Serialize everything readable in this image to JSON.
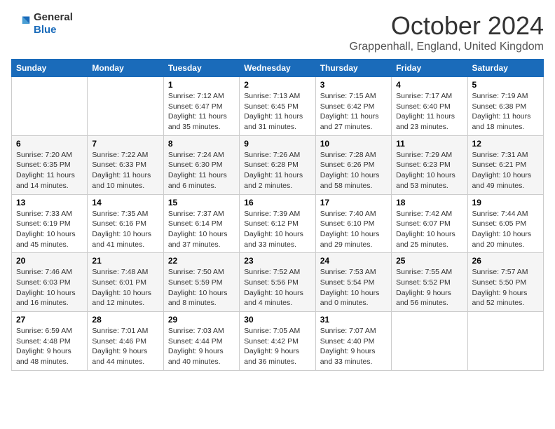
{
  "logo": {
    "general": "General",
    "blue": "Blue"
  },
  "header": {
    "month": "October 2024",
    "location": "Grappenhall, England, United Kingdom"
  },
  "weekdays": [
    "Sunday",
    "Monday",
    "Tuesday",
    "Wednesday",
    "Thursday",
    "Friday",
    "Saturday"
  ],
  "weeks": [
    [
      {
        "day": "",
        "info": ""
      },
      {
        "day": "",
        "info": ""
      },
      {
        "day": "1",
        "info": "Sunrise: 7:12 AM\nSunset: 6:47 PM\nDaylight: 11 hours and 35 minutes."
      },
      {
        "day": "2",
        "info": "Sunrise: 7:13 AM\nSunset: 6:45 PM\nDaylight: 11 hours and 31 minutes."
      },
      {
        "day": "3",
        "info": "Sunrise: 7:15 AM\nSunset: 6:42 PM\nDaylight: 11 hours and 27 minutes."
      },
      {
        "day": "4",
        "info": "Sunrise: 7:17 AM\nSunset: 6:40 PM\nDaylight: 11 hours and 23 minutes."
      },
      {
        "day": "5",
        "info": "Sunrise: 7:19 AM\nSunset: 6:38 PM\nDaylight: 11 hours and 18 minutes."
      }
    ],
    [
      {
        "day": "6",
        "info": "Sunrise: 7:20 AM\nSunset: 6:35 PM\nDaylight: 11 hours and 14 minutes."
      },
      {
        "day": "7",
        "info": "Sunrise: 7:22 AM\nSunset: 6:33 PM\nDaylight: 11 hours and 10 minutes."
      },
      {
        "day": "8",
        "info": "Sunrise: 7:24 AM\nSunset: 6:30 PM\nDaylight: 11 hours and 6 minutes."
      },
      {
        "day": "9",
        "info": "Sunrise: 7:26 AM\nSunset: 6:28 PM\nDaylight: 11 hours and 2 minutes."
      },
      {
        "day": "10",
        "info": "Sunrise: 7:28 AM\nSunset: 6:26 PM\nDaylight: 10 hours and 58 minutes."
      },
      {
        "day": "11",
        "info": "Sunrise: 7:29 AM\nSunset: 6:23 PM\nDaylight: 10 hours and 53 minutes."
      },
      {
        "day": "12",
        "info": "Sunrise: 7:31 AM\nSunset: 6:21 PM\nDaylight: 10 hours and 49 minutes."
      }
    ],
    [
      {
        "day": "13",
        "info": "Sunrise: 7:33 AM\nSunset: 6:19 PM\nDaylight: 10 hours and 45 minutes."
      },
      {
        "day": "14",
        "info": "Sunrise: 7:35 AM\nSunset: 6:16 PM\nDaylight: 10 hours and 41 minutes."
      },
      {
        "day": "15",
        "info": "Sunrise: 7:37 AM\nSunset: 6:14 PM\nDaylight: 10 hours and 37 minutes."
      },
      {
        "day": "16",
        "info": "Sunrise: 7:39 AM\nSunset: 6:12 PM\nDaylight: 10 hours and 33 minutes."
      },
      {
        "day": "17",
        "info": "Sunrise: 7:40 AM\nSunset: 6:10 PM\nDaylight: 10 hours and 29 minutes."
      },
      {
        "day": "18",
        "info": "Sunrise: 7:42 AM\nSunset: 6:07 PM\nDaylight: 10 hours and 25 minutes."
      },
      {
        "day": "19",
        "info": "Sunrise: 7:44 AM\nSunset: 6:05 PM\nDaylight: 10 hours and 20 minutes."
      }
    ],
    [
      {
        "day": "20",
        "info": "Sunrise: 7:46 AM\nSunset: 6:03 PM\nDaylight: 10 hours and 16 minutes."
      },
      {
        "day": "21",
        "info": "Sunrise: 7:48 AM\nSunset: 6:01 PM\nDaylight: 10 hours and 12 minutes."
      },
      {
        "day": "22",
        "info": "Sunrise: 7:50 AM\nSunset: 5:59 PM\nDaylight: 10 hours and 8 minutes."
      },
      {
        "day": "23",
        "info": "Sunrise: 7:52 AM\nSunset: 5:56 PM\nDaylight: 10 hours and 4 minutes."
      },
      {
        "day": "24",
        "info": "Sunrise: 7:53 AM\nSunset: 5:54 PM\nDaylight: 10 hours and 0 minutes."
      },
      {
        "day": "25",
        "info": "Sunrise: 7:55 AM\nSunset: 5:52 PM\nDaylight: 9 hours and 56 minutes."
      },
      {
        "day": "26",
        "info": "Sunrise: 7:57 AM\nSunset: 5:50 PM\nDaylight: 9 hours and 52 minutes."
      }
    ],
    [
      {
        "day": "27",
        "info": "Sunrise: 6:59 AM\nSunset: 4:48 PM\nDaylight: 9 hours and 48 minutes."
      },
      {
        "day": "28",
        "info": "Sunrise: 7:01 AM\nSunset: 4:46 PM\nDaylight: 9 hours and 44 minutes."
      },
      {
        "day": "29",
        "info": "Sunrise: 7:03 AM\nSunset: 4:44 PM\nDaylight: 9 hours and 40 minutes."
      },
      {
        "day": "30",
        "info": "Sunrise: 7:05 AM\nSunset: 4:42 PM\nDaylight: 9 hours and 36 minutes."
      },
      {
        "day": "31",
        "info": "Sunrise: 7:07 AM\nSunset: 4:40 PM\nDaylight: 9 hours and 33 minutes."
      },
      {
        "day": "",
        "info": ""
      },
      {
        "day": "",
        "info": ""
      }
    ]
  ]
}
